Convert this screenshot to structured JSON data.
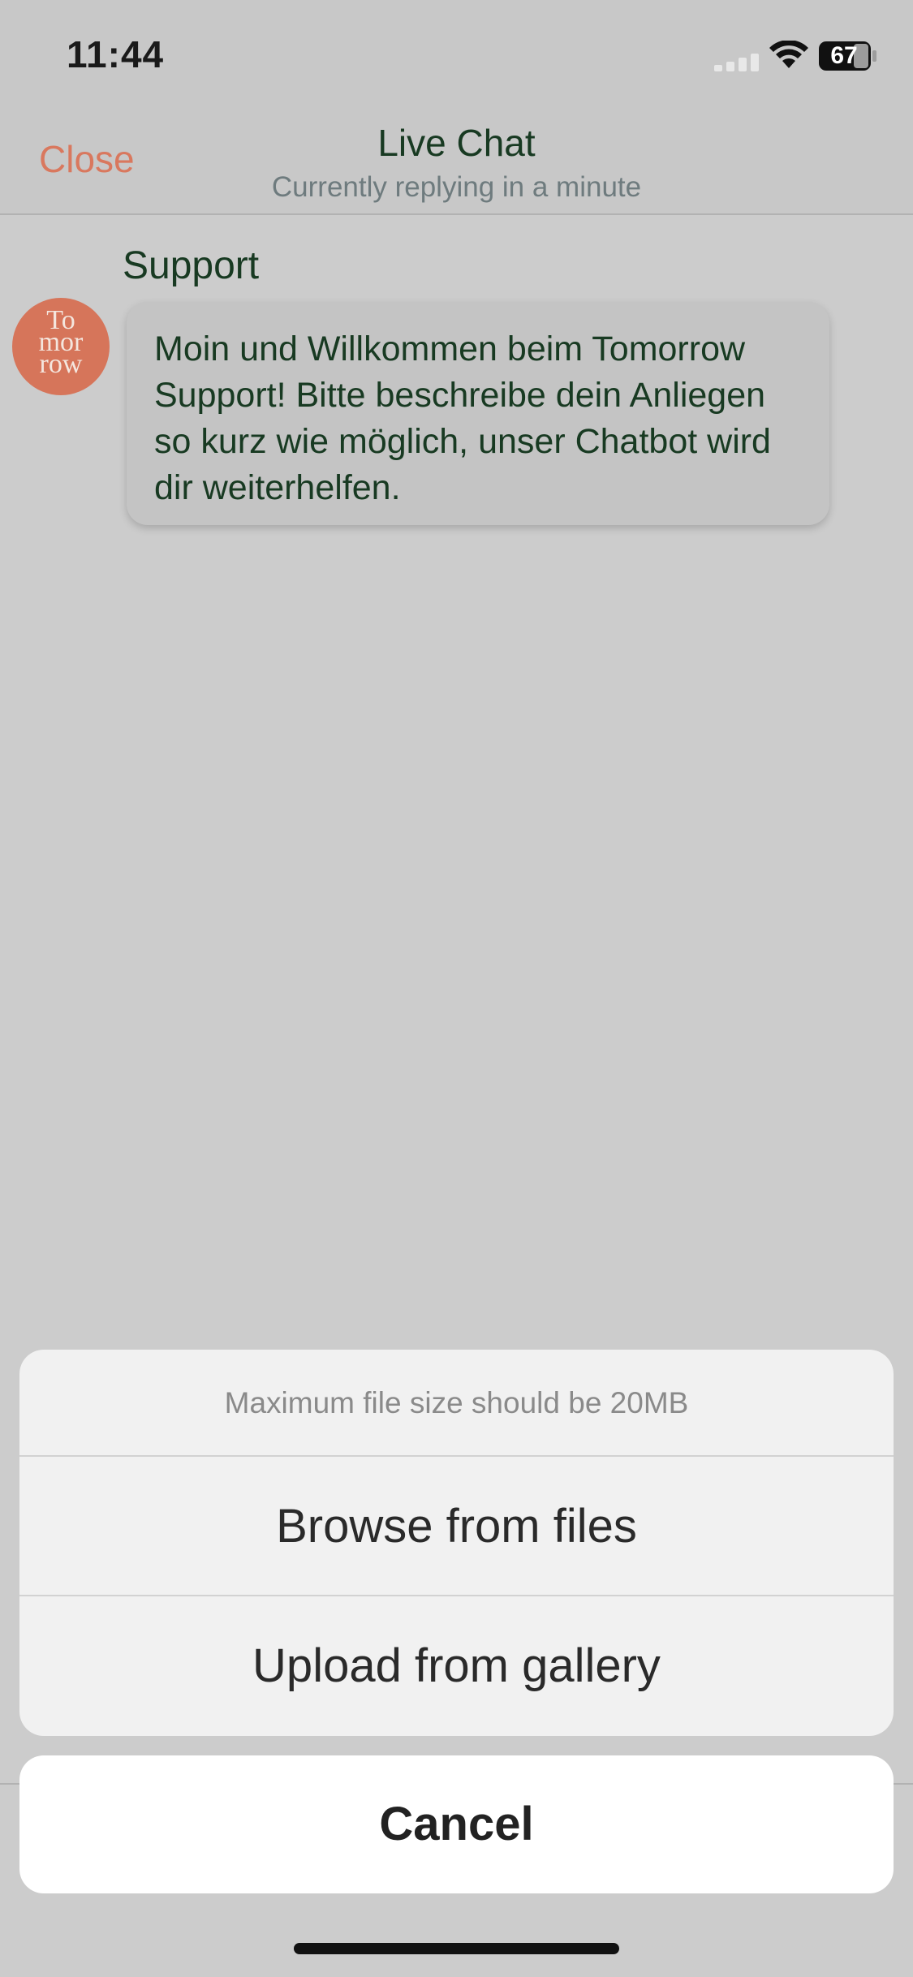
{
  "status_bar": {
    "time": "11:44",
    "battery_level": "67"
  },
  "header": {
    "close_label": "Close",
    "title": "Live Chat",
    "subtitle": "Currently replying in a minute"
  },
  "chat": {
    "sender": "Support",
    "avatar_lines": [
      "To",
      "mor",
      "row"
    ],
    "message": "Moin und Willkommen beim Tomorrow Support! Bitte beschreibe dein Anliegen so kurz wie möglich, unser Chatbot wird dir weiterhelfen."
  },
  "action_sheet": {
    "hint": "Maximum file size should be 20MB",
    "browse_label": "Browse from files",
    "gallery_label": "Upload from gallery",
    "cancel_label": "Cancel"
  },
  "colors": {
    "accent": "#d9785e",
    "text_dark_green": "#183a22",
    "avatar_bg": "#d6755a"
  }
}
